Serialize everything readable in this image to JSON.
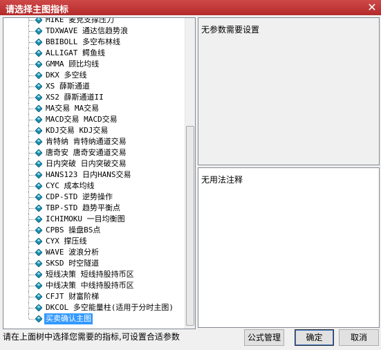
{
  "window": {
    "title": "请选择主图指标",
    "close_symbol": "✕"
  },
  "tree": {
    "items": [
      {
        "label": "MIKE 麦克支撑压力"
      },
      {
        "label": "TDXWAVE 通达信趋势浪"
      },
      {
        "label": "BBIBOLL 多空布林线"
      },
      {
        "label": "ALLIGAT 鳄鱼线"
      },
      {
        "label": "GMMA 顾比均线"
      },
      {
        "label": "DKX 多空线"
      },
      {
        "label": "XS 薛斯通道"
      },
      {
        "label": "XS2 薛斯通道II"
      },
      {
        "label": "MA交易 MA交易"
      },
      {
        "label": "MACD交易 MACD交易"
      },
      {
        "label": "KDJ交易 KDJ交易"
      },
      {
        "label": "肯特纳 肯特纳通道交易"
      },
      {
        "label": "唐奇安 唐奇安通道交易"
      },
      {
        "label": "日内突破 日内突破交易"
      },
      {
        "label": "HANS123 日内HANS交易"
      },
      {
        "label": "CYC 成本均线"
      },
      {
        "label": "CDP-STD 逆势操作"
      },
      {
        "label": "TBP-STD 趋势平衡点"
      },
      {
        "label": "ICHIMOKU 一目均衡图"
      },
      {
        "label": "CPBS 操盘BS点"
      },
      {
        "label": "CYX 撑压线"
      },
      {
        "label": "WAVE 波浪分析"
      },
      {
        "label": "SKSD 时空隧道"
      },
      {
        "label": "短线决策 短线持股持币区"
      },
      {
        "label": "中线决策 中线持股持币区"
      },
      {
        "label": "CFJT 财富阶梯"
      },
      {
        "label": "DKCOL 多空能量柱(适用于分时主图)"
      },
      {
        "label": "买卖确认主图"
      }
    ],
    "selected_index": 27,
    "icon": "indicator-gem-icon"
  },
  "params_panel": {
    "text": "无参数需要设置"
  },
  "notes_panel": {
    "text": "无用法注释"
  },
  "status": {
    "text": "请在上面树中选择您需要的指标,可设置合适参数"
  },
  "buttons": {
    "formula": "公式管理",
    "ok": "确定",
    "cancel": "取消"
  },
  "colors": {
    "titlebar": "#c0392b",
    "selection": "#3399ff",
    "gem": "#1a8fb0"
  }
}
